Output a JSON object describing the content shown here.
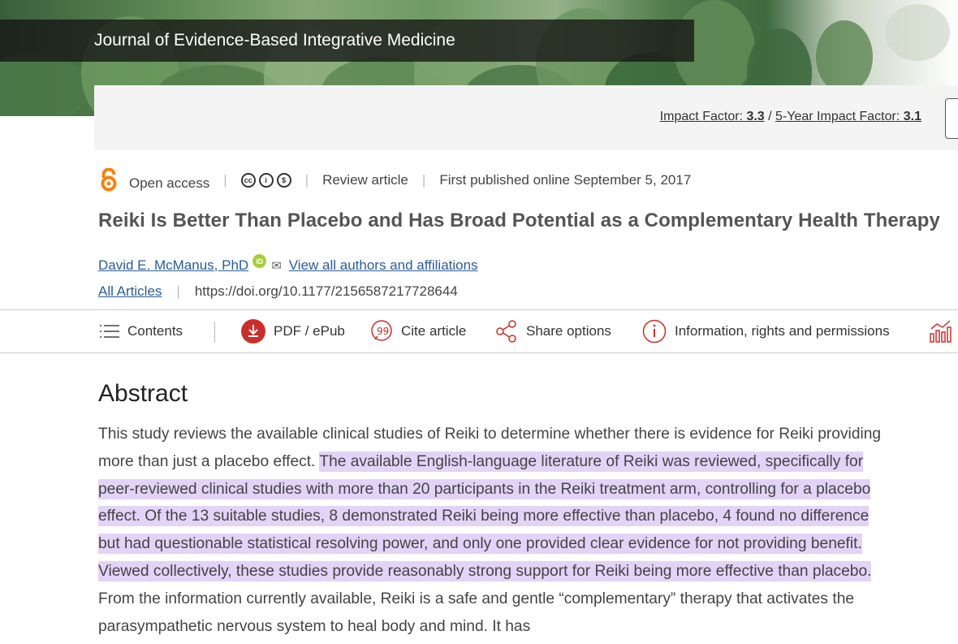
{
  "journal": {
    "title": "Journal of Evidence-Based Integrative Medicine"
  },
  "impact": {
    "impact_label": "Impact Factor:",
    "impact_value": "3.3",
    "separator": "/",
    "five_year_label": "5-Year Impact Factor:",
    "five_year_value": "3.1"
  },
  "meta": {
    "access": "Open access",
    "license_icons": [
      "cc",
      "by",
      "nc"
    ],
    "article_type": "Review article",
    "published": "First published online September 5, 2017"
  },
  "article": {
    "title": "Reiki Is Better Than Placebo and Has Broad Potential as a Complementary Health Therapy",
    "author": "David E. McManus, PhD",
    "view_all": "View all authors and affiliations",
    "all_articles": "All Articles",
    "doi": "https://doi.org/10.1177/2156587217728644"
  },
  "toolbar": {
    "contents": "Contents",
    "pdf": "PDF / ePub",
    "cite": "Cite article",
    "share": "Share options",
    "info": "Information, rights and permissions"
  },
  "abstract": {
    "heading": "Abstract",
    "text_before": "This study reviews the available clinical studies of Reiki to determine whether there is evidence for Reiki providing more than just a placebo effect. ",
    "text_highlighted": "The available English-language literature of Reiki was reviewed, specifically for peer-reviewed clinical studies with more than 20 participants in the Reiki treatment arm, controlling for a placebo effect. Of the 13 suitable studies, 8 demonstrated Reiki being more effective than placebo, 4 found no difference but had questionable statistical resolving power, and only one provided clear evidence for not providing benefit. Viewed collectively, these studies provide reasonably strong support for Reiki being more effective than placebo.",
    "text_after": " From the information currently available, Reiki is a safe and gentle “complementary” therapy that activates the parasympathetic nervous system to heal body and mind. It has",
    "highlight_color": "#e3d3f7"
  },
  "colors": {
    "link": "#2a5c9a",
    "accent_red": "#c9302c",
    "open_access_orange": "#f68212",
    "orcid_green": "#a6ce39"
  }
}
